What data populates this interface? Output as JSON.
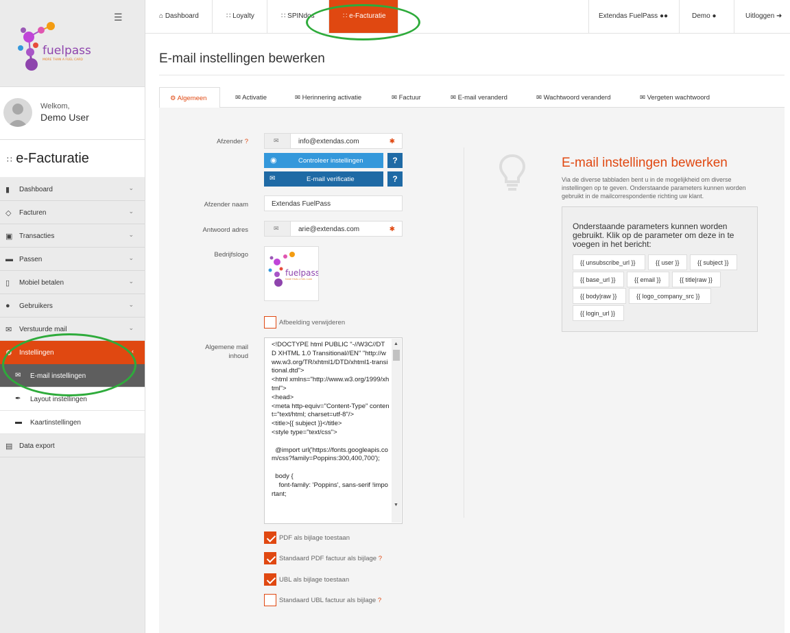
{
  "sidebar": {
    "brand": {
      "name": "fuelpass",
      "tagline": "MORE THAN A FUEL CARD"
    },
    "welcome": "Welkom,",
    "user": "Demo User",
    "module_title": "e-Facturatie",
    "menu": [
      {
        "label": "Dashboard",
        "icon": "bar-chart-icon"
      },
      {
        "label": "Facturen",
        "icon": "tag-icon"
      },
      {
        "label": "Transacties",
        "icon": "cart-icon"
      },
      {
        "label": "Passen",
        "icon": "card-icon"
      },
      {
        "label": "Mobiel betalen",
        "icon": "phone-icon"
      },
      {
        "label": "Gebruikers",
        "icon": "users-icon"
      },
      {
        "label": "Verstuurde mail",
        "icon": "mail-icon"
      },
      {
        "label": "Instellingen",
        "icon": "gear-icon"
      }
    ],
    "submenu": [
      {
        "label": "E-mail instellingen",
        "icon": "mail-icon"
      },
      {
        "label": "Layout instellingen",
        "icon": "brush-icon"
      },
      {
        "label": "Kaartinstellingen",
        "icon": "card-icon"
      }
    ],
    "data_export": "Data export"
  },
  "topbar": {
    "tabs": [
      "Dashboard",
      "Loyalty",
      "SPINdos",
      "e-Facturatie"
    ],
    "right": [
      "Extendas FuelPass",
      "Demo",
      "Uitloggen"
    ]
  },
  "page": {
    "title": "E-mail instellingen bewerken",
    "tabs": [
      "Algemeen",
      "Activatie",
      "Herinnering activatie",
      "Factuur",
      "E-mail veranderd",
      "Wachtwoord veranderd",
      "Vergeten wachtwoord"
    ]
  },
  "form": {
    "afzender_label": "Afzender",
    "afzender_value": "info@extendas.com",
    "check_btn": "Controleer instellingen",
    "verify_btn": "E-mail verificatie",
    "help": "?",
    "afzender_naam_label": "Afzender naam",
    "afzender_naam_value": "Extendas FuelPass",
    "antwoord_label": "Antwoord adres",
    "antwoord_value": "arie@extendas.com",
    "logo_label": "Bedrijfslogo",
    "remove_image": "Afbeelding verwijderen",
    "mail_label": "Algemene mail inhoud",
    "mail_body": "<!DOCTYPE html PUBLIC \"-//W3C//DTD XHTML 1.0 Transitional//EN\" \"http://www.w3.org/TR/xhtml1/DTD/xhtml1-transitional.dtd\">\n<html xmlns=\"http://www.w3.org/1999/xhtml\">\n<head>\n<meta http-equiv=\"Content-Type\" content=\"text/html; charset=utf-8\"/>\n<title>{{ subject }}</title>\n<style type=\"text/css\">\n\n  @import url('https://fonts.googleapis.com/css?family=Poppins:300,400,700');\n\n  body {\n    font-family: 'Poppins', sans-serif !important;",
    "pdf_attach": "PDF als bijlage toestaan",
    "std_pdf": "Standaard PDF factuur als bijlage",
    "ubl_attach": "UBL als bijlage toestaan",
    "std_ubl": "Standaard UBL factuur als bijlage",
    "checks": {
      "pdf_attach": true,
      "std_pdf": true,
      "ubl_attach": true,
      "std_ubl": false,
      "remove_image": false
    }
  },
  "info": {
    "title": "E-mail instellingen bewerken",
    "text": "Via de diverse tabbladen bent u in de mogelijkheid om diverse instellingen op te geven. Onderstaande parameters kunnen worden gebruikt in de mailcorrespondentie richting uw klant.",
    "params_text": "Onderstaande parameters kunnen worden gebruikt. Klik op de parameter om deze in te voegen in het bericht:",
    "params": [
      "{{ unsubscribe_url }}",
      "{{ user }}",
      "{{ subject }}",
      "{{ base_url }}",
      "{{ email }}",
      "{{ title|raw }}",
      "{{ body|raw }}",
      "{{ logo_company_src }}",
      "{{ login_url }}"
    ]
  },
  "colors": {
    "accent": "#e04811",
    "blue": "#3498db",
    "dark_blue": "#1f6aa5",
    "annotation": "#2eab3b"
  }
}
